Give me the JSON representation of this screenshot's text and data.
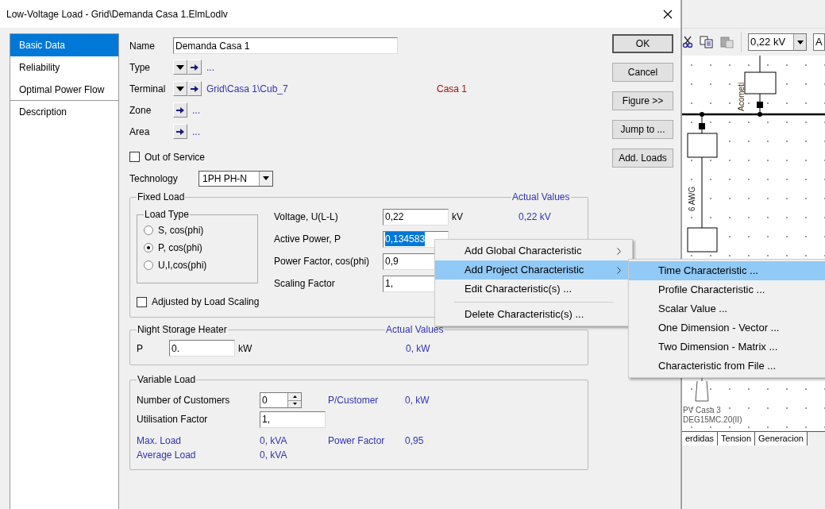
{
  "window": {
    "title": "Low-Voltage Load - Grid\\Demanda Casa 1.ElmLodlv"
  },
  "nav": [
    {
      "label": "Basic Data",
      "selected": true
    },
    {
      "label": "Reliability",
      "selected": false
    },
    {
      "label": "Optimal Power Flow",
      "selected": false
    },
    {
      "label": "Description",
      "selected": false
    }
  ],
  "basic": {
    "name": {
      "label": "Name",
      "value": "Demanda Casa 1"
    },
    "refs": [
      {
        "label": "Type",
        "dropdown": true,
        "value": "..."
      },
      {
        "label": "Terminal",
        "dropdown": true,
        "value": "Grid\\Casa 1\\Cub_7",
        "note": "Casa 1"
      },
      {
        "label": "Zone",
        "dropdown": false,
        "value": "..."
      },
      {
        "label": "Area",
        "dropdown": false,
        "value": "..."
      }
    ],
    "out_of_service": {
      "label": "Out of Service",
      "checked": false
    },
    "technology": {
      "label": "Technology",
      "value": "1PH PH-N"
    }
  },
  "fixed_load": {
    "title": "Fixed Load",
    "actual_title": "Actual Values",
    "load_type": {
      "title": "Load Type",
      "options": [
        {
          "label": "S, cos(phi)",
          "selected": false
        },
        {
          "label": "P, cos(phi)",
          "selected": true
        },
        {
          "label": "U,I,cos(phi)",
          "selected": false
        }
      ]
    },
    "rows": [
      {
        "label": "Voltage, U(L-L)",
        "value": "0,22",
        "highlighted": false,
        "unit": "kV",
        "actual": "0,22 kV"
      },
      {
        "label": "Active Power, P",
        "value": "0,134583",
        "highlighted": true
      },
      {
        "label": "Power Factor, cos(phi)",
        "value": "0,9",
        "highlighted": false
      },
      {
        "label": "Scaling Factor",
        "value": "1,",
        "highlighted": false
      }
    ],
    "adjusted": {
      "label": "Adjusted by Load Scaling",
      "checked": false
    }
  },
  "night_storage": {
    "title": "Night Storage Heater",
    "actual_title": "Actual Values",
    "label": "P",
    "value": "0.",
    "unit": "kW",
    "actual": "0, kW"
  },
  "variable_load": {
    "title": "Variable Load",
    "customers": {
      "label": "Number of Customers",
      "value": "0",
      "per_label": "P/Customer",
      "per_value": "0, kW"
    },
    "utilisation": {
      "label": "Utilisation Factor",
      "value": "1,"
    },
    "max_load": {
      "label": "Max. Load",
      "value": "0, kVA",
      "pf_label": "Power Factor",
      "pf_value": "0,95"
    },
    "average_load": {
      "label": "Average Load",
      "value": "0, kVA"
    }
  },
  "buttons": [
    {
      "label": "OK",
      "default": true
    },
    {
      "label": "Cancel",
      "default": false
    },
    {
      "label": "Figure >>",
      "default": false
    },
    {
      "label": "Jump to ...",
      "default": false
    },
    {
      "label": "Add. Loads",
      "default": false
    }
  ],
  "context_menu": [
    {
      "kind": "item",
      "label": "Add Global Characteristic",
      "submenu": true,
      "selected": false
    },
    {
      "kind": "item",
      "label": "Add Project Characteristic",
      "submenu": true,
      "selected": true
    },
    {
      "kind": "item",
      "label": "Edit Characteristic(s) ...",
      "submenu": false,
      "selected": false
    },
    {
      "kind": "separator"
    },
    {
      "kind": "item",
      "label": "Delete Characteristic(s) ...",
      "submenu": false,
      "selected": false
    }
  ],
  "submenu": [
    {
      "label": "Time Characteristic ...",
      "selected": true
    },
    {
      "label": "Profile Characteristic ...",
      "selected": false
    },
    {
      "label": "Scalar Value ...",
      "selected": false
    },
    {
      "label": "One Dimension - Vector ...",
      "selected": false
    },
    {
      "label": "Two Dimension - Matrix ...",
      "selected": false
    },
    {
      "label": "Characteristic from File ...",
      "selected": false
    }
  ],
  "background_app": {
    "voltage": "0,22 kV",
    "combo_2": "A",
    "diagram_labels": {
      "top": "Acometi",
      "line": "6 AWG",
      "pv_name": "PV Casa 3",
      "pv_type": "DEG15MC.20(II)"
    },
    "tabs": [
      "erdidas",
      "Tension",
      "Generacion"
    ]
  }
}
